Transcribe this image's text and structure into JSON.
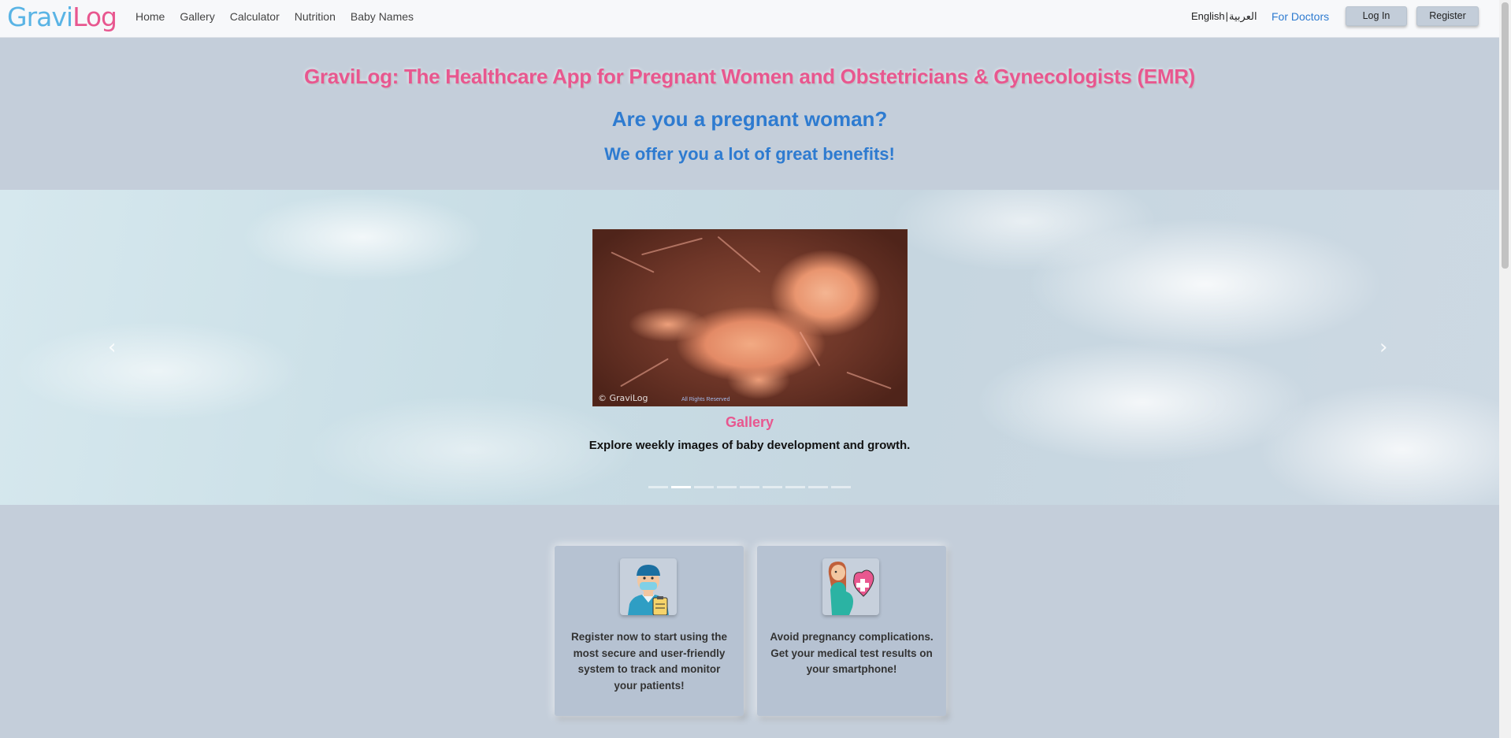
{
  "navbar": {
    "logo": {
      "part1": "Gravi",
      "part2": "Log"
    },
    "links": [
      "Home",
      "Gallery",
      "Calculator",
      "Nutrition",
      "Baby Names"
    ],
    "lang_english": "English",
    "lang_separator": "|",
    "lang_arabic": "العربية",
    "for_doctors": "For Doctors",
    "login": "Log In",
    "register": "Register"
  },
  "hero": {
    "title": "GraviLog: The Healthcare App for Pregnant Women and Obstetricians & Gynecologists (EMR)",
    "question": "Are you a pregnant woman?",
    "subtitle": "We offer you a lot of great benefits!"
  },
  "carousel": {
    "prev_icon": "chevron-left-icon",
    "next_icon": "chevron-right-icon",
    "slide_title": "Gallery",
    "slide_description": "Explore weekly images of baby development and growth.",
    "image_watermark": "© GraviLog",
    "image_rights": "All Rights Reserved",
    "indicator_count": 9,
    "active_index": 1
  },
  "cards": [
    {
      "icon": "doctor-icon",
      "text": "Register now to start using the most secure and user-friendly system to track and monitor your patients!"
    },
    {
      "icon": "pregnant-woman-heart-icon",
      "text": "Avoid pregnancy complications. Get your medical test results on your smartphone!"
    }
  ],
  "colors": {
    "brand_pink": "#e8578f",
    "brand_blue": "#2e7bd0",
    "logo_blue": "#5ab4e5",
    "page_bg": "#c4ceda"
  }
}
